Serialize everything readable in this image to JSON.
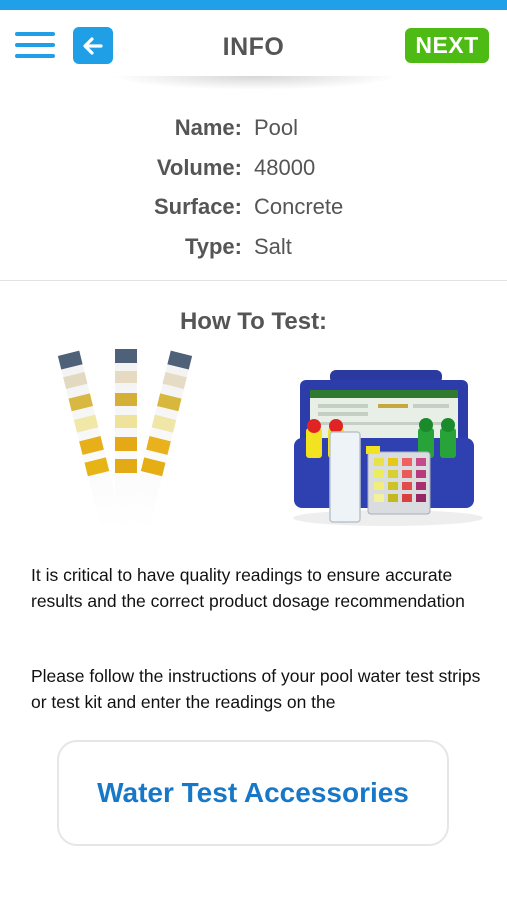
{
  "header": {
    "title": "INFO",
    "next_label": "NEXT",
    "menu_icon": "hamburger-menu-icon",
    "back_icon": "arrow-left-icon",
    "accent_color": "#1fa0e8",
    "next_color": "#4dbb14"
  },
  "pool_info": [
    {
      "label": "Name:",
      "value": "Pool"
    },
    {
      "label": "Volume:",
      "value": "48000"
    },
    {
      "label": "Surface:",
      "value": "Concrete"
    },
    {
      "label": "Type:",
      "value": "Salt"
    }
  ],
  "how_to_test": {
    "heading": "How To Test:",
    "paragraph1": "It is critical to have quality readings to ensure accurate results and the correct product dosage recommendation",
    "paragraph2": "Please follow the instructions of your pool water test strips or test kit and enter the readings on the"
  },
  "accessories_button": {
    "label": "Water Test Accessories",
    "color": "#1878c8"
  }
}
